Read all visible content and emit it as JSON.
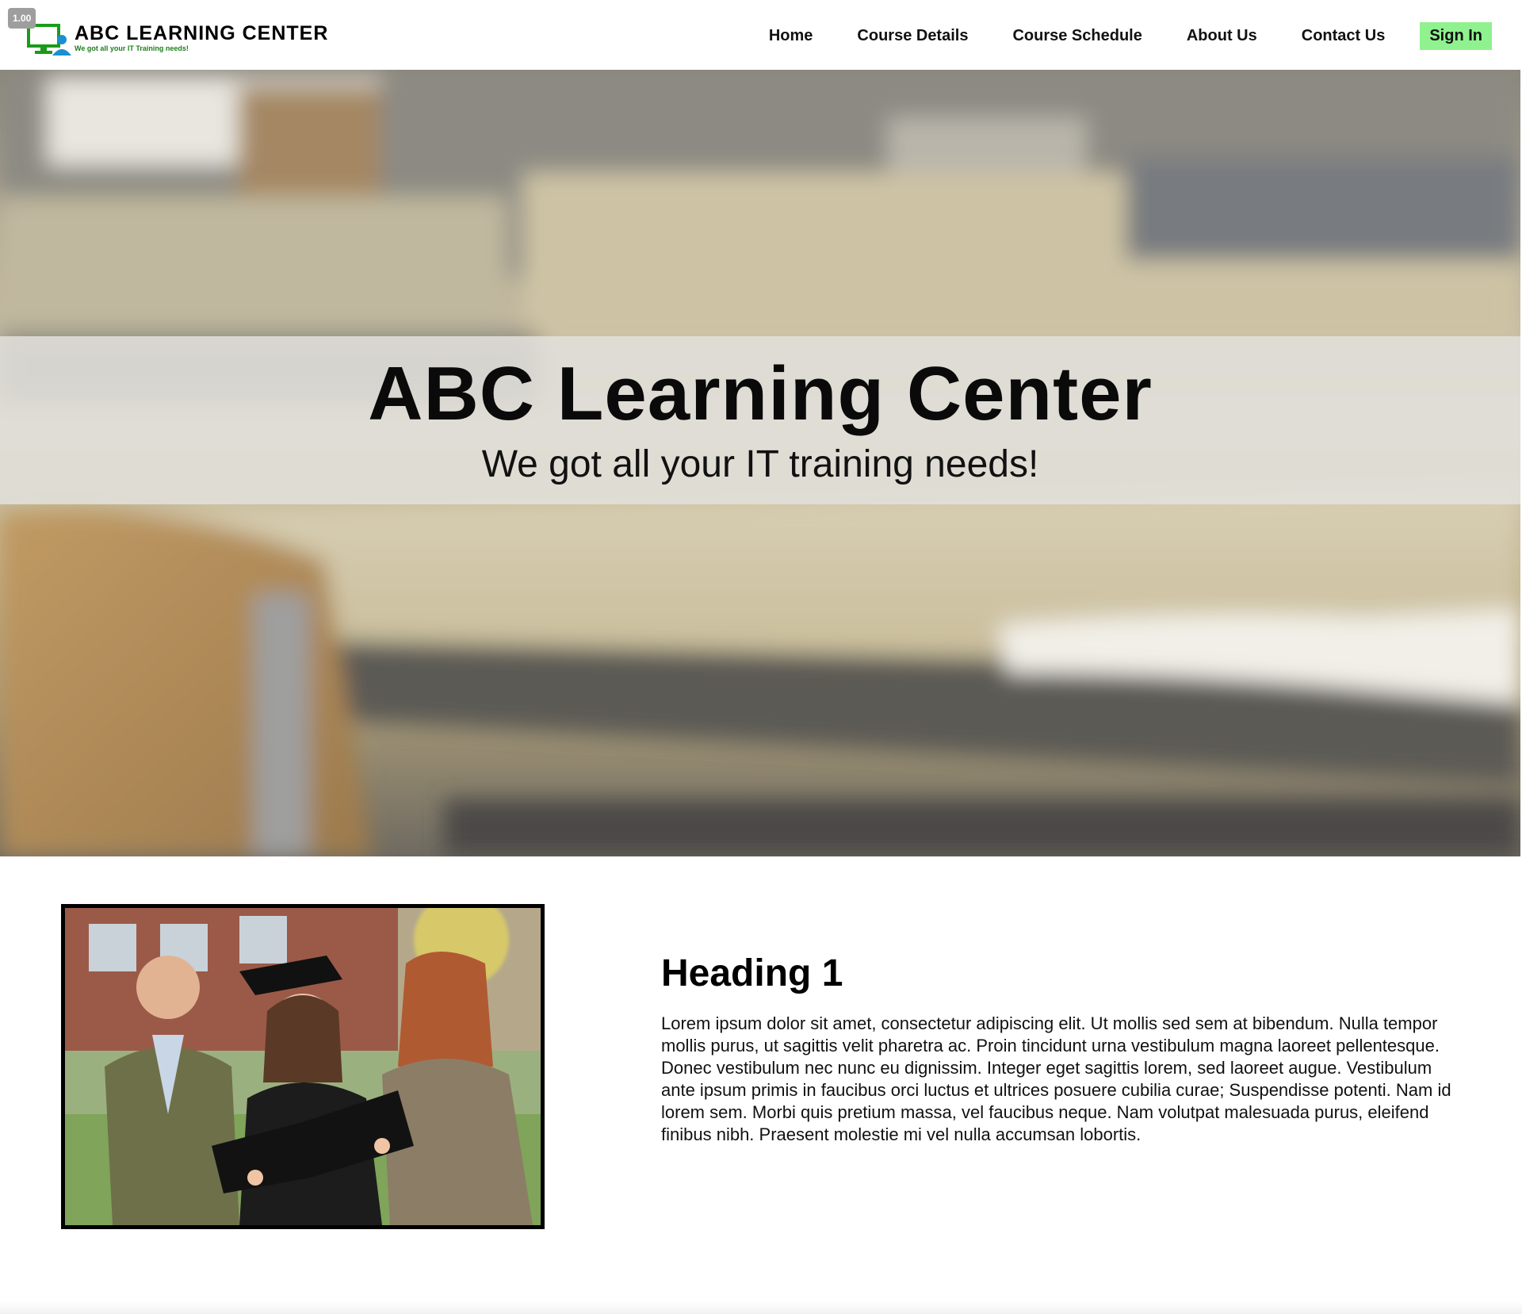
{
  "zoom_badge": "1.00",
  "brand": {
    "name": "ABC LEARNING CENTER",
    "tagline": "We got all your IT Training needs!",
    "accent": "#1a9b1a",
    "accent_alt": "#1b8fd1"
  },
  "nav": {
    "items": [
      {
        "label": "Home"
      },
      {
        "label": "Course Details"
      },
      {
        "label": "Course Schedule"
      },
      {
        "label": "About Us"
      },
      {
        "label": "Contact Us"
      }
    ],
    "signin_label": "Sign In",
    "signin_color": "#8ff28f"
  },
  "hero": {
    "title": "ABC Learning Center",
    "subtitle": "We got all your IT training needs!"
  },
  "main": {
    "heading": "Heading 1",
    "body": "Lorem ipsum dolor sit amet, consectetur adipiscing elit. Ut mollis sed sem at bibendum. Nulla tempor mollis purus, ut sagittis velit pharetra ac. Proin tincidunt urna vestibulum magna laoreet pellentesque. Donec vestibulum nec nunc eu dignissim. Integer eget sagittis lorem, sed laoreet augue. Vestibulum ante ipsum primis in faucibus orci luctus et ultrices posuere cubilia curae; Suspendisse potenti. Nam id lorem sem. Morbi quis pretium massa, vel faucibus neque. Nam volutpat malesuada purus, eleifend finibus nibh. Praesent molestie mi vel nulla accumsan lobortis."
  }
}
